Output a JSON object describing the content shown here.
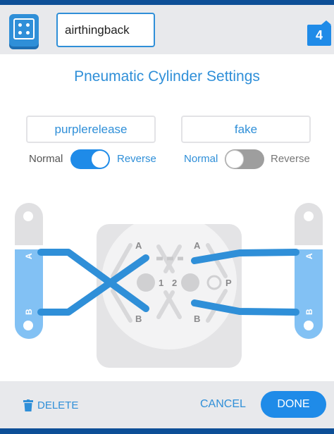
{
  "header": {
    "block_name": "airthingback",
    "slot_number": "4",
    "block_icon": "robot-block-icon"
  },
  "title": "Pneumatic Cylinder Settings",
  "cylinders": [
    {
      "port": "purplerelease",
      "normal_label": "Normal",
      "reverse_label": "Reverse",
      "reversed": true
    },
    {
      "port": "fake",
      "normal_label": "Normal",
      "reverse_label": "Reverse",
      "reversed": false
    }
  ],
  "diagram": {
    "left_cylinder_a": "A",
    "left_cylinder_b": "B",
    "right_cylinder_a": "A",
    "right_cylinder_b": "B",
    "valve_a1": "A",
    "valve_b1": "B",
    "valve_a2": "A",
    "valve_b2": "B",
    "valve_port1": "1",
    "valve_port2": "2",
    "valve_pressure": "P"
  },
  "footer": {
    "delete_label": "DELETE",
    "cancel_label": "CANCEL",
    "done_label": "DONE"
  },
  "colors": {
    "accent": "#2f8fd8",
    "tube": "#2f8fd8",
    "cylinder_fill": "#82c1f4",
    "valve_body": "#e4e4e6"
  }
}
